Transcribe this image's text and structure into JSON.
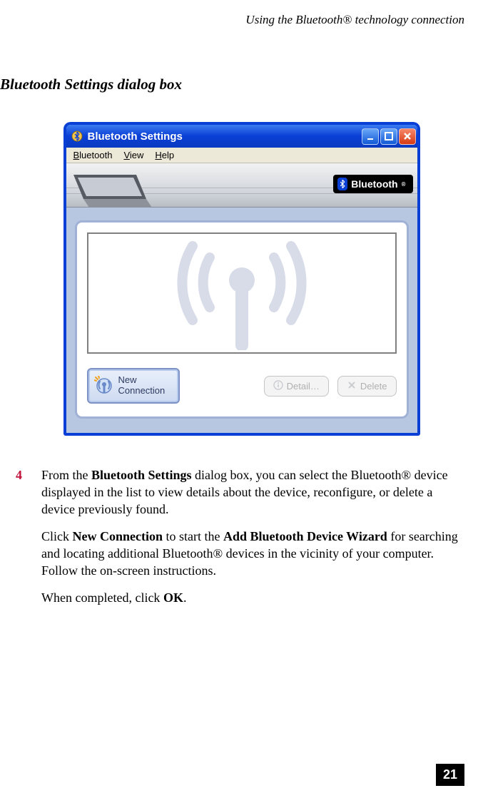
{
  "header": {
    "running_title": "Using the Bluetooth® technology connection"
  },
  "section_title": "Bluetooth Settings dialog box",
  "window": {
    "title": "Bluetooth Settings",
    "menubar": {
      "bluetooth": "Bluetooth",
      "view": "View",
      "help": "Help"
    },
    "banner": {
      "brand_text": "Bluetooth"
    },
    "buttons": {
      "new_connection_line1": "New",
      "new_connection_line2": "Connection",
      "detail": "Detail…",
      "delete": "Delete"
    }
  },
  "step": {
    "number": "4",
    "para1_pre": "From the ",
    "para1_bold1": "Bluetooth Settings",
    "para1_post1": " dialog box, you can select the Bluetooth® device displayed in the list to view details about the device, reconfigure, or delete a device previously found.",
    "para2_pre": "Click ",
    "para2_bold1": "New Connection",
    "para2_mid": " to start the ",
    "para2_bold2": "Add Bluetooth Device Wizard",
    "para2_post": " for searching and locating additional Bluetooth® devices in the vicinity of your computer. Follow the on-screen instructions.",
    "para3_pre": "When completed, click ",
    "para3_bold": "OK",
    "para3_post": "."
  },
  "footer": {
    "page_number": "21"
  }
}
